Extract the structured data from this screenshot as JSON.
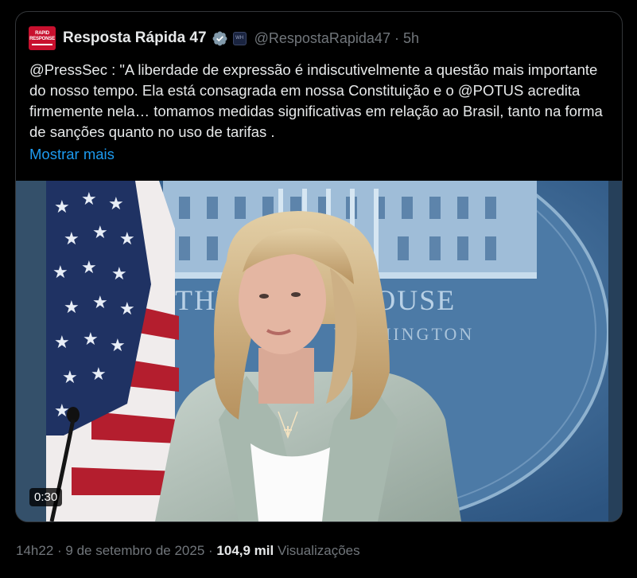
{
  "account": {
    "avatar_text_top": "RAPID",
    "avatar_text_bottom": "RESPONSE",
    "display_name": "Resposta Rápida 47",
    "badge_text": "WH",
    "handle": "@RespostaRapida47",
    "separator": "·",
    "time_ago": "5h"
  },
  "tweet": {
    "text": "@PressSec : \"A liberdade de expressão é indiscutivelmente a questão mais importante do nosso tempo. Ela está consagrada em nossa Constituição e o @POTUS acredita firmemente nela… tomamos medidas significativas em relação ao Brasil, tanto na forma de sanções quanto no uso de tarifas .",
    "show_more": "Mostrar mais"
  },
  "video": {
    "duration": "0:30",
    "backdrop_text": "THE WHITE HOUSE",
    "backdrop_subtext": "WASHINGTON"
  },
  "meta": {
    "time": "14h22",
    "sep1": "·",
    "date": "9 de setembro de 2025",
    "sep2": "·",
    "views_count": "104,9 mil",
    "views_label": "Visualizações"
  },
  "colors": {
    "background": "#000000",
    "text_primary": "#e7e9ea",
    "text_secondary": "#71767b",
    "link": "#1d9bf0",
    "verified": "#829aab",
    "avatar_red": "#c8102e"
  },
  "icons": {
    "verified": "verified-badge-icon",
    "affiliate": "affiliate-badge-icon"
  }
}
